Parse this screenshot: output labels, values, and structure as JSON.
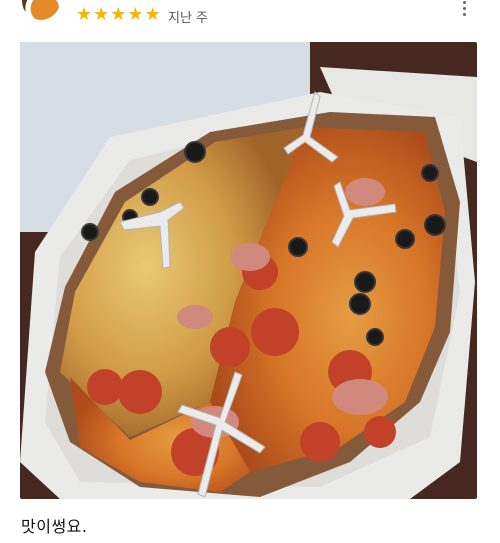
{
  "review": {
    "rating_stars": 5,
    "star_glyph": "★",
    "date": "지난 주",
    "text": "맛이썽요.",
    "accent_color": "#f7b500"
  },
  "icons": {
    "more": "more-vertical-icon",
    "avatar": "user-avatar"
  }
}
